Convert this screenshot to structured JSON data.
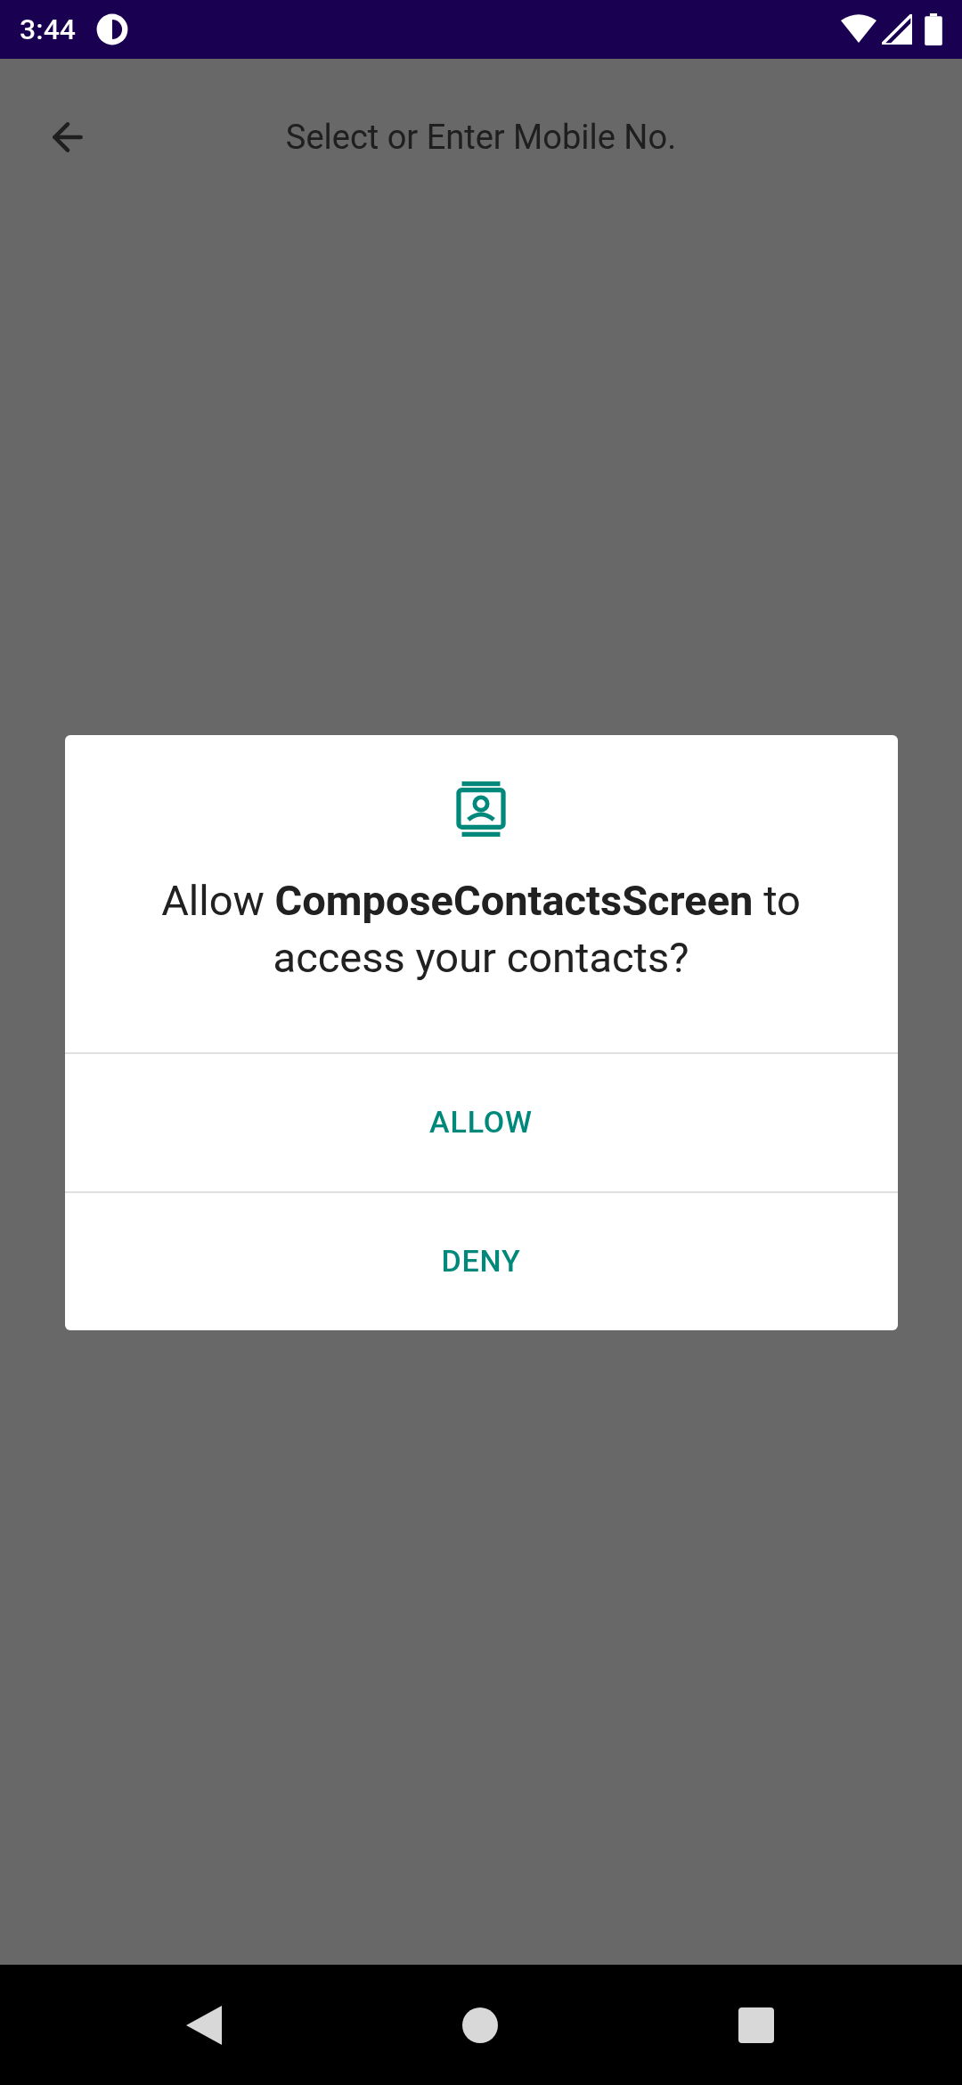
{
  "status_bar": {
    "time": "3:44"
  },
  "app_bar": {
    "title": "Select or Enter Mobile No."
  },
  "dialog": {
    "message": "Allow **ComposeContactsScreen** to access your contacts?",
    "buttons": [
      "ALLOW",
      "DENY"
    ]
  }
}
